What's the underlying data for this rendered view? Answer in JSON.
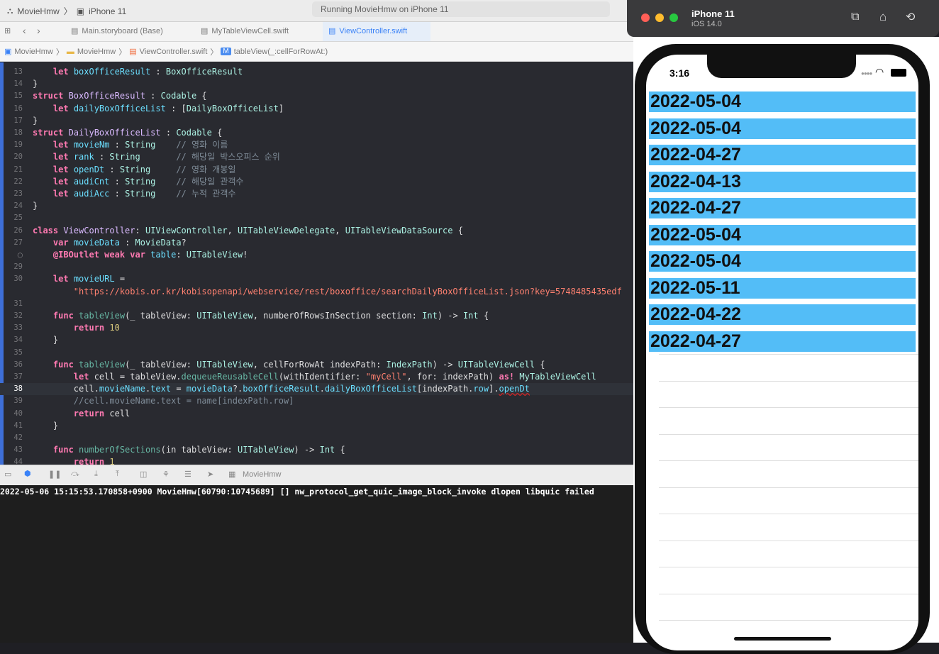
{
  "toolbar": {
    "project": "MovieHmw",
    "device": "iPhone 11",
    "status": "Running MovieHmw on iPhone 11"
  },
  "tabs": [
    {
      "label": "Main.storyboard (Base)"
    },
    {
      "label": "MyTableViewCell.swift"
    },
    {
      "label": "ViewController.swift"
    }
  ],
  "jumpbar": [
    "MovieHmw",
    "MovieHmw",
    "ViewController.swift",
    "tableView(_:cellForRowAt:)"
  ],
  "gutter": [
    "13",
    "14",
    "15",
    "16",
    "17",
    "18",
    "19",
    "20",
    "21",
    "22",
    "23",
    "24",
    "25",
    "26",
    "27",
    "",
    "29",
    "30",
    "",
    "31",
    "32",
    "33",
    "34",
    "35",
    "36",
    "37",
    "38",
    "39",
    "40",
    "41",
    "42",
    "43",
    "44"
  ],
  "code": [
    [
      "    ",
      "let ",
      "boxOfficeResult ",
      ": ",
      "BoxOfficeResult"
    ],
    [
      "}"
    ],
    [
      "struct ",
      "BoxOfficeResult ",
      ": ",
      "Codable ",
      "{"
    ],
    [
      "    ",
      "let ",
      "dailyBoxOfficeList ",
      ": [",
      "DailyBoxOfficeList",
      "]"
    ],
    [
      "}"
    ],
    [
      "struct ",
      "DailyBoxOfficeList ",
      ": ",
      "Codable ",
      "{"
    ],
    [
      "    ",
      "let ",
      "movieNm ",
      ": ",
      "String",
      "    ",
      "// 영화 이름"
    ],
    [
      "    ",
      "let ",
      "rank ",
      ": ",
      "String",
      "       ",
      "// 해당일 박스오피스 순위"
    ],
    [
      "    ",
      "let ",
      "openDt ",
      ": ",
      "String",
      "     ",
      "// 영화 개봉일"
    ],
    [
      "    ",
      "let ",
      "audiCnt ",
      ": ",
      "String",
      "    ",
      "// 해당일 관객수"
    ],
    [
      "    ",
      "let ",
      "audiAcc ",
      ": ",
      "String",
      "    ",
      "// 누적 관객수"
    ],
    [
      "}"
    ],
    [
      ""
    ],
    [
      "class ",
      "ViewController",
      ": ",
      "UIViewController",
      ", ",
      "UITableViewDelegate",
      ", ",
      "UITableViewDataSource",
      " {"
    ],
    [
      "    ",
      "var ",
      "movieData ",
      ": ",
      "MovieData",
      "?"
    ],
    [
      "    ",
      "@IBOutlet ",
      "weak ",
      "var ",
      "table",
      ": ",
      "UITableView",
      "!"
    ],
    [
      ""
    ],
    [
      "    ",
      "let ",
      "movieURL ",
      "="
    ],
    [
      "        ",
      "\"https://kobis.or.kr/kobisopenapi/webservice/rest/boxoffice/searchDailyBoxOfficeList.json?key=5748485435edf"
    ],
    [
      ""
    ],
    [
      "    ",
      "func ",
      "tableView",
      "(_ tableView: ",
      "UITableView",
      ", numberOfRowsInSection section: ",
      "Int",
      ") -> ",
      "Int",
      " {"
    ],
    [
      "        ",
      "return ",
      "10"
    ],
    [
      "    }"
    ],
    [
      ""
    ],
    [
      "    ",
      "func ",
      "tableView",
      "(_ tableView: ",
      "UITableView",
      ", cellForRowAt indexPath: ",
      "IndexPath",
      ") -> ",
      "UITableViewCell",
      " {"
    ],
    [
      "        ",
      "let ",
      "cell = tableView.",
      "dequeueReusableCell",
      "(withIdentifier: ",
      "\"myCell\"",
      ", for: indexPath) ",
      "as! ",
      "MyTableViewCell"
    ],
    [
      "        cell.",
      "movieName",
      ".",
      "text",
      " = ",
      "movieData",
      "?.",
      "boxOfficeResult",
      ".",
      "dailyBoxOfficeList",
      "[indexPath.",
      "row",
      "].",
      "openDt"
    ],
    [
      "        ",
      "//cell.movieName.text = name[indexPath.row]"
    ],
    [
      "        ",
      "return ",
      "cell"
    ],
    [
      "    }"
    ],
    [
      ""
    ],
    [
      "    ",
      "func ",
      "numberOfSections",
      "(in tableView: ",
      "UITableView",
      ") -> ",
      "Int",
      " {"
    ],
    [
      "        ",
      "return ",
      "1"
    ]
  ],
  "debugbar": {
    "target": "MovieHmw"
  },
  "console": {
    "line": "2022-05-06 15:15:53.170858+0900 MovieHmw[60790:10745689] [] nw_protocol_get_quic_image_block_invoke dlopen libquic failed"
  },
  "simulator": {
    "device": "iPhone 11",
    "os": "iOS 14.0",
    "time": "3:16"
  },
  "rows": [
    "2022-05-04",
    "2022-05-04",
    "2022-04-27",
    "2022-04-13",
    "2022-04-27",
    "2022-05-04",
    "2022-05-04",
    "2022-05-11",
    "2022-04-22",
    "2022-04-27"
  ],
  "colors": {
    "cell": "#53bdf7",
    "accent": "#3a82f7"
  }
}
